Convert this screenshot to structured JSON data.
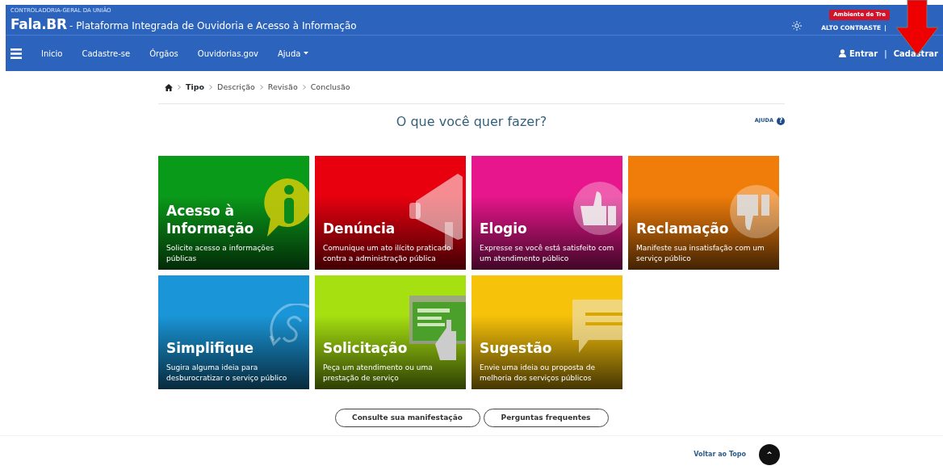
{
  "header": {
    "org": "CONTROLADORIA-GERAL DA UNIÃO",
    "brand": "Fala.BR",
    "subtitle": "- Plataforma Integrada de Ouvidoria e Acesso à Informação",
    "env_badge": "Ambiente de Tre",
    "contrast_link": "ALTO CONTRASTE",
    "separator": "|"
  },
  "nav": {
    "items": [
      {
        "label": "Inicio",
        "dropdown": false
      },
      {
        "label": "Cadastre-se",
        "dropdown": false
      },
      {
        "label": "Órgãos",
        "dropdown": false
      },
      {
        "label": "Ouvidorias.gov",
        "dropdown": false
      },
      {
        "label": "Ajuda",
        "dropdown": true
      }
    ],
    "login": "Entrar",
    "separator": "|",
    "register": "Cadastrar"
  },
  "breadcrumb": [
    {
      "label": "Tipo",
      "selected": true
    },
    {
      "label": "Descrição",
      "selected": false
    },
    {
      "label": "Revisão",
      "selected": false
    },
    {
      "label": "Conclusão",
      "selected": false
    }
  ],
  "heading": "O que você quer fazer?",
  "help": "AJUDA",
  "help_icon": "?",
  "tiles": [
    {
      "kind": "info",
      "title": "Acesso à Informação",
      "text": "Solicite acesso a informações públicas",
      "color": "#0a9a1a"
    },
    {
      "kind": "megaphone",
      "title": "Denúncia",
      "text": "Comunique um ato ilícito praticado contra a administração pública",
      "color": "#e8000e"
    },
    {
      "kind": "thumbs-up",
      "title": "Elogio",
      "text": "Expresse se você está satisfeito com um atendimento público",
      "color": "#e8168c"
    },
    {
      "kind": "thumbs-down",
      "title": "Reclamação",
      "text": "Manifeste sua insatisfação com um serviço público",
      "color": "#f07d0a"
    },
    {
      "kind": "cycle",
      "title": "Simplifique",
      "text": "Sugira alguma ideia para desburocratizar o serviço público",
      "color": "#1a96d8"
    },
    {
      "kind": "screen",
      "title": "Solicitação",
      "text": "Peça um atendimento ou uma prestação de serviço",
      "color": "#a6e010"
    },
    {
      "kind": "speech",
      "title": "Sugestão",
      "text": "Envie uma ideia ou proposta de melhoria dos serviços públicos",
      "color": "#f7c20a"
    }
  ],
  "buttons": [
    "Consulte sua manifestação",
    "Perguntas frequentes"
  ],
  "footer": {
    "back_to_top": "Voltar ao Topo",
    "top_button": "^"
  }
}
